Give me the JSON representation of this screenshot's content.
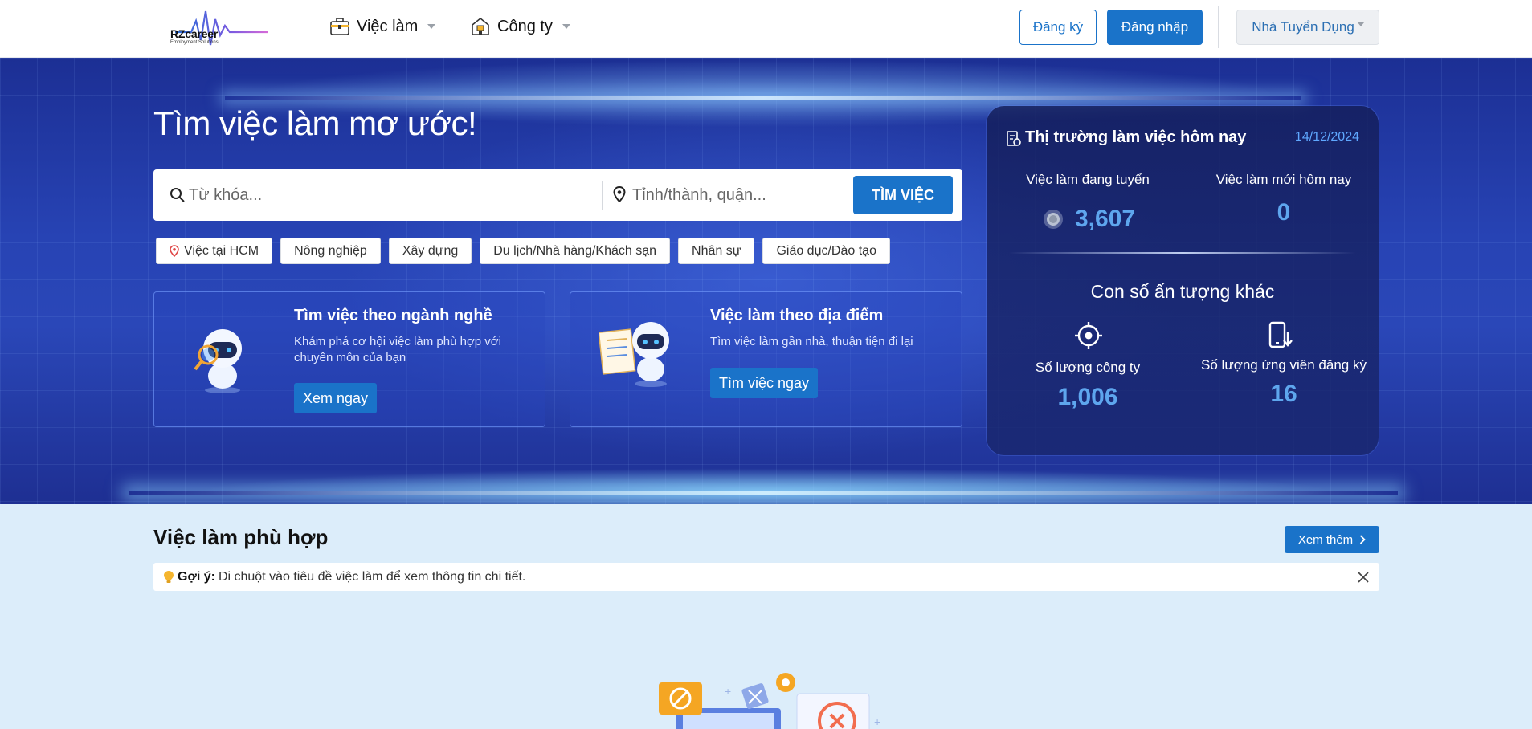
{
  "header": {
    "logo_text": "RZcareer",
    "logo_sub": "Employment Solutions",
    "nav": [
      {
        "label": "Việc làm",
        "icon": "briefcase-icon"
      },
      {
        "label": "Công ty",
        "icon": "building-icon"
      }
    ],
    "register_label": "Đăng ký",
    "login_label": "Đăng nhập",
    "employer_label": "Nhà Tuyển Dụng"
  },
  "hero": {
    "title": "Tìm việc làm mơ ước!",
    "search": {
      "keyword_placeholder": "Từ khóa...",
      "location_placeholder": "Tỉnh/thành, quận...",
      "button_label": "TÌM VIỆC"
    },
    "tags": [
      "Việc tại HCM",
      "Nông nghiệp",
      "Xây dựng",
      "Du lịch/Nhà hàng/Khách sạn",
      "Nhân sự",
      "Giáo dục/Đào tạo"
    ],
    "cards": [
      {
        "title": "Tìm việc theo ngành nghề",
        "desc": "Khám phá cơ hội việc làm phù hợp với chuyên môn của bạn",
        "button": "Xem ngay"
      },
      {
        "title": "Việc làm theo địa điểm",
        "desc": "Tìm việc làm gần nhà, thuận tiện đi lại",
        "button": "Tìm việc ngay"
      }
    ]
  },
  "market": {
    "title": "Thị trường làm việc hôm nay",
    "date": "14/12/2024",
    "jobs_hiring_label": "Việc làm đang tuyển",
    "jobs_hiring_value": "3,607",
    "jobs_new_label": "Việc làm mới hôm nay",
    "jobs_new_value": "0",
    "other_title": "Con số ấn tượng khác",
    "companies_label": "Số lượng công ty",
    "companies_value": "1,006",
    "candidates_label": "Số lượng ứng viên đăng ký",
    "candidates_value": "16"
  },
  "section": {
    "title": "Việc làm phù hợp",
    "see_more": "Xem thêm",
    "hint_prefix": "Gợi ý:",
    "hint_text": "Di chuột vào tiêu đề việc làm để xem thông tin chi tiết."
  },
  "colors": {
    "primary": "#1a73c9",
    "hero_bg": "#2743b4",
    "accent_value": "#5ea6ee",
    "section_bg": "#dcedfa"
  }
}
